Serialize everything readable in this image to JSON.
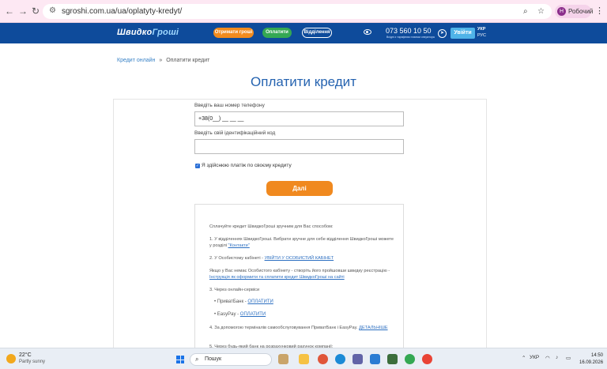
{
  "browser": {
    "url": "sgroshi.com.ua/ua/oplatyty-kredyt/",
    "profile_initial": "Н",
    "profile_name": "Робочий"
  },
  "header": {
    "logo_part1": "Швидко",
    "logo_part2": "Гроші",
    "get_money": "Отримати гроші",
    "pay": "Оплатити",
    "branches": "Відділення",
    "phone": "073 560 10 50",
    "phone_sub": "Вхідні з тарифним планом оператора",
    "login": "Увійти",
    "lang_ua": "УКР",
    "lang_ru": "РУС"
  },
  "breadcrumb": {
    "home": "Кредит онлайн",
    "sep": "»",
    "current": "Оплатити кредит"
  },
  "page": {
    "title": "Оплатити кредит",
    "phone_label": "Введіть ваш номер телефону",
    "phone_value": "+38(0__) __ __ __",
    "id_label": "Введіть свій ідентифікаційний код",
    "id_value": "",
    "checkbox_label": "Я здійснюю платіж по своєму кредиту",
    "checkbox_checked": true,
    "next_button": "Далі"
  },
  "info": {
    "intro": "Сплачуйте кредит ШвидкоГроші зручним для Вас способом:",
    "item1_text": "1. У відділеннях ШвидкоГроші. Вибрати зручне для себе відділення ШвидкоГроші можете у розділі",
    "item1_link": "\"Контакти\"",
    "item2_text": "2. У Особистому кабінеті -",
    "item2_link": "УВІЙТИ У ОСОБИСТИЙ КАБІНЕТ",
    "note_text": "Якщо у Вас немає Особистого кабінету - створіть його пройшовши швидку реєстрацію -",
    "note_link": "Інструкція як оформити та сплатити кредит ШвидкоГроші на сайті",
    "item3_text": "3. Через онлайн-сервіси",
    "privat": "ПриватБанк -",
    "privat_link": "ОПЛАТИТИ",
    "easypay": "EasyPay -",
    "easypay_link": "ОПЛАТИТИ",
    "item4_text": "4. За допомогою терміналів самообслуговування ПриватБанк і EasyPay.",
    "item4_link": "ДЕТАЛЬНІШЕ",
    "item5_text": "5. Через будь-який банк на розрахунковий рахунок компанії:"
  },
  "taskbar": {
    "temp": "22°C",
    "weather": "Partly sunny",
    "search": "Пошук",
    "lang": "УКР",
    "time": "14:50",
    "date": "16.09.2026"
  }
}
